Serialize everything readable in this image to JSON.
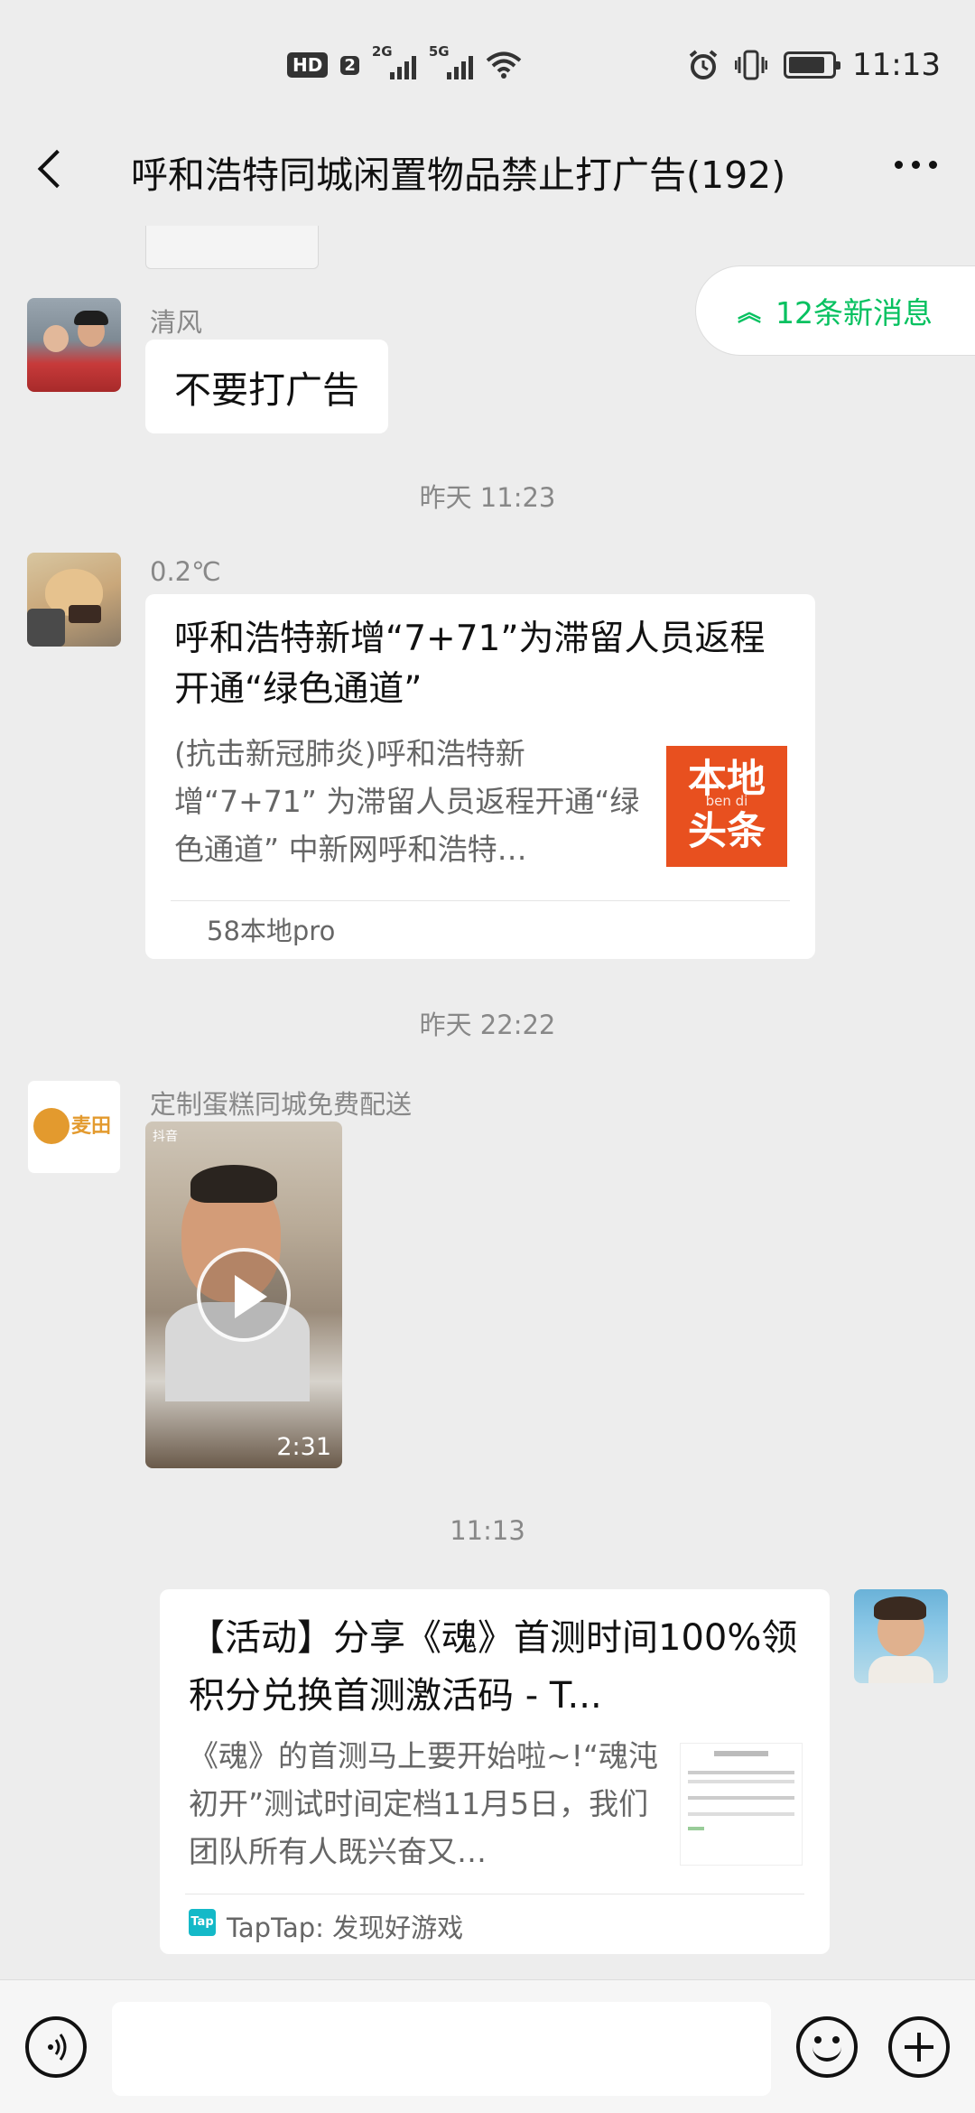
{
  "status_bar": {
    "hd": "HD",
    "sim1": "2G",
    "sim2": "5G",
    "time": "11:13",
    "icons": [
      "hd-icon",
      "signal-2g-icon",
      "signal-5g-icon",
      "wifi-icon",
      "alarm-icon",
      "vibrate-icon",
      "battery-icon"
    ]
  },
  "header": {
    "title": "呼和浩特同城闲置物品禁止打广告(192)",
    "back_icon": "back-arrow-icon",
    "more_icon": "more-icon"
  },
  "new_messages": {
    "label": "12条新消息",
    "icon": "double-chevron-up-icon",
    "color": "#07c160"
  },
  "messages": [
    {
      "sender": "清风",
      "text": "不要打广告"
    },
    {
      "time": "昨天 11:23"
    },
    {
      "sender": "0.2℃",
      "card": {
        "title": "呼和浩特新增“7+71”为滞留人员返程开通“绿色通道”",
        "desc": "(抗击新冠肺炎)呼和浩特新增“7+71” 为滞留人员返程开通“绿色通道” 中新网呼和浩特…",
        "thumb_text": "本地头条",
        "thumb_sub": "ben di",
        "source": "58本地pro"
      }
    },
    {
      "time": "昨天 22:22"
    },
    {
      "sender": "定制蛋糕同城免费配送",
      "video": {
        "duration": "2:31",
        "overlay": "抖音"
      },
      "avatar_logo": "麦田"
    },
    {
      "time": "11:13"
    },
    {
      "self": true,
      "card": {
        "title": "【活动】分享《魂》首测时间100%领积分兑换首测激活码 - T...",
        "desc": "《魂》的首测马上要开始啦~!“魂沌初开”测试时间定档11月5日，我们团队所有人既兴奋又…",
        "source": "TapTap: 发现好游戏",
        "source_icon": "taptap-icon"
      }
    }
  ],
  "input_bar": {
    "voice_icon": "voice-icon",
    "emoji_icon": "emoji-icon",
    "plus_icon": "plus-icon"
  },
  "colors": {
    "background": "#ededed",
    "accent": "#07c160",
    "taptap": "#14b9c8",
    "bendi": "#e8501f"
  }
}
